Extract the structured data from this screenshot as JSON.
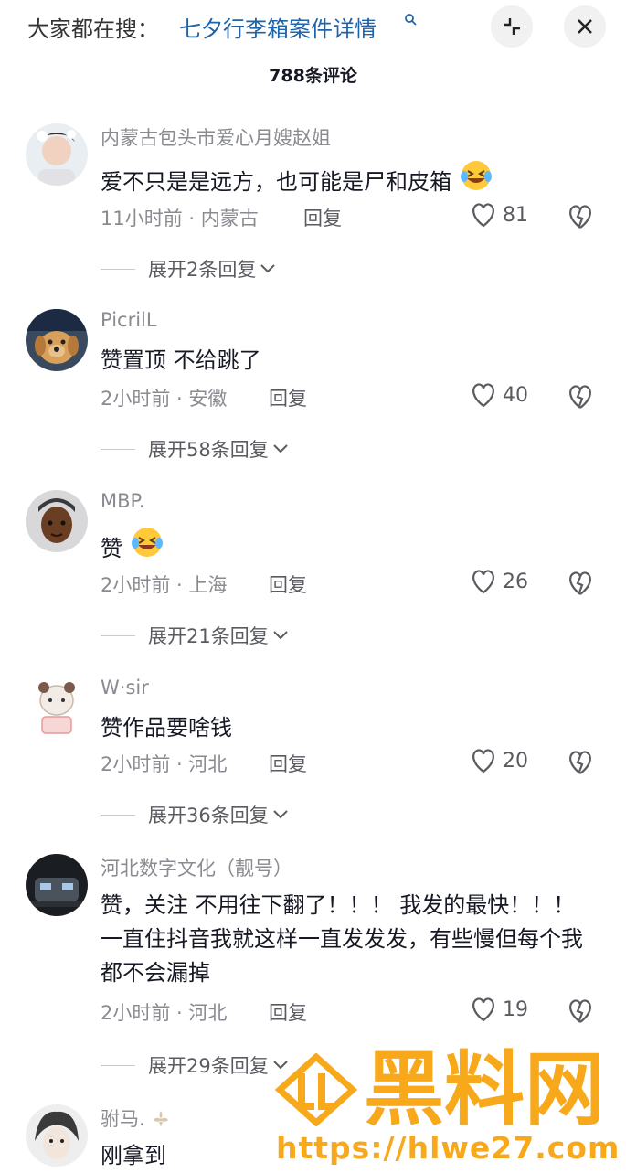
{
  "header": {
    "search_prefix": "大家都在搜：",
    "search_term": "七夕行李箱案件详情",
    "search_term_icon": "search-icon",
    "collapse_icon": "collapse-icon",
    "close_icon": "close-icon",
    "comment_count": "788条评论"
  },
  "comments": [
    {
      "user": "内蒙古包头市爱心月嫂赵姐",
      "text": "爱不只是是远方，也可能是尸和皮箱",
      "emoji": "laughing-crying-emoji",
      "meta": "11小时前 · 内蒙古",
      "reply": "回复",
      "likes": "81",
      "expand": "展开2条回复"
    },
    {
      "user": "PicrilL",
      "text": "赞置顶  不给跳了",
      "meta": "2小时前 · 安徽",
      "reply": "回复",
      "likes": "40",
      "expand": "展开58条回复"
    },
    {
      "user": "MBP.",
      "text": "赞",
      "emoji": "laughing-crying-emoji",
      "meta": "2小时前 · 上海",
      "reply": "回复",
      "likes": "26",
      "expand": "展开21条回复"
    },
    {
      "user": "W·sir",
      "text": "赞作品要啥钱",
      "meta": "2小时前 · 河北",
      "reply": "回复",
      "likes": "20",
      "expand": "展开36条回复"
    },
    {
      "user": "河北数字文化（靓号）",
      "text": "赞，关注 不用往下翻了！！！ 我发的最快！！！ 一直住抖音我就这样一直发发发，有些慢但每个我都不会漏掉",
      "meta": "2小时前 · 河北",
      "reply": "回复",
      "likes": "19",
      "expand": "展开29条回复"
    },
    {
      "user": "驸马.",
      "text": "刚拿到"
    }
  ],
  "watermark": {
    "title": "黑料网",
    "url": "https://hlwe27.com"
  },
  "colors": {
    "accent_link": "#1f63a8",
    "watermark": "#f7a81b",
    "muted": "#8a8b91"
  }
}
